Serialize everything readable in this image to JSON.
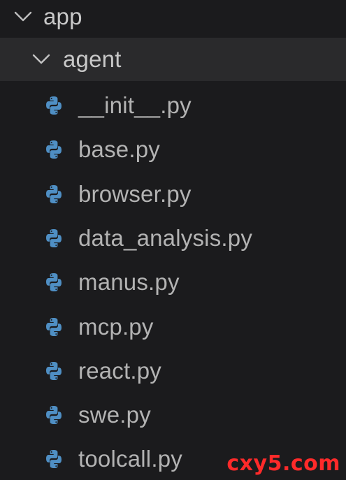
{
  "explorer": {
    "root_folder": {
      "label": "app",
      "expanded": true,
      "icon": "chevron-down-icon"
    },
    "sub_folder": {
      "label": "agent",
      "expanded": true,
      "selected": true,
      "icon": "chevron-down-icon"
    },
    "files": [
      {
        "label": "__init__.py",
        "icon": "python-file-icon"
      },
      {
        "label": "base.py",
        "icon": "python-file-icon"
      },
      {
        "label": "browser.py",
        "icon": "python-file-icon"
      },
      {
        "label": "data_analysis.py",
        "icon": "python-file-icon"
      },
      {
        "label": "manus.py",
        "icon": "python-file-icon"
      },
      {
        "label": "mcp.py",
        "icon": "python-file-icon"
      },
      {
        "label": "react.py",
        "icon": "python-file-icon"
      },
      {
        "label": "swe.py",
        "icon": "python-file-icon"
      },
      {
        "label": "toolcall.py",
        "icon": "python-file-icon"
      }
    ]
  },
  "watermark": {
    "text": "cxy5.com",
    "color": "#ff2a2a"
  },
  "colors": {
    "background": "#1b1b1d",
    "selected_row": "#2a2a2c",
    "python_icon": "#4f8fc4",
    "text": "#b3b3b3"
  }
}
